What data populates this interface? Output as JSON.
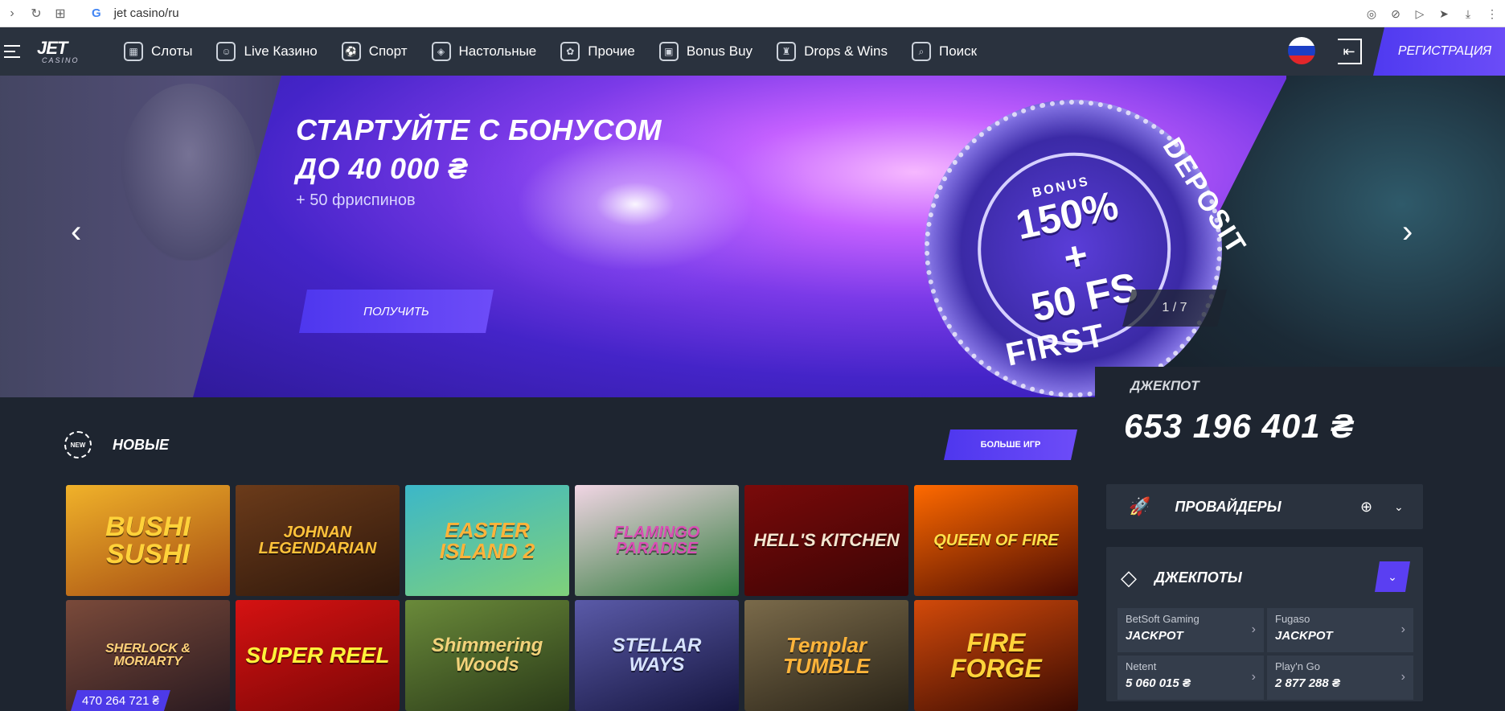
{
  "browser": {
    "url": "jet casino/ru",
    "google_letter": "G"
  },
  "header": {
    "logo_top": "JET",
    "logo_bottom": "CASINO",
    "nav": [
      {
        "label": "Слоты",
        "icon": "slots-icon"
      },
      {
        "label": "Live Казино",
        "icon": "live-dealer-icon"
      },
      {
        "label": "Спорт",
        "icon": "sport-icon"
      },
      {
        "label": "Настольные",
        "icon": "table-games-icon"
      },
      {
        "label": "Прочие",
        "icon": "other-games-icon"
      },
      {
        "label": "Bonus Buy",
        "icon": "gift-icon"
      },
      {
        "label": "Drops & Wins",
        "icon": "trophy-icon"
      },
      {
        "label": "Поиск",
        "icon": "search-icon"
      }
    ],
    "register_label": "РЕГИСТРАЦИЯ",
    "flag_colors": [
      "#ffffff",
      "#1c3fc6",
      "#e2262a"
    ]
  },
  "hero": {
    "title_line1": "СТАРТУЙТЕ С БОНУСОМ",
    "title_line2": "ДО 40 000 ₴",
    "subtitle": "+ 50 фриспинов",
    "button_label": "ПОЛУЧИТЬ",
    "badge_bonus": "BONUS",
    "badge_line1": "150%",
    "badge_plus": "+",
    "badge_line2": "50 FS",
    "badge_first": "FIRST",
    "badge_deposit": "DEPOSIT",
    "slide_counter": "1 / 7"
  },
  "new_games": {
    "icon_text": "NEW",
    "title": "НОВЫЕ",
    "more_label": "БОЛЬШЕ ИГР",
    "games": [
      {
        "name": "BUSHI SUSHI",
        "colors": [
          "#f0b22a",
          "#a44b12"
        ],
        "text_color": "#ffd23a",
        "size": 34
      },
      {
        "name": "JOHNAN LEGENDARIAN",
        "colors": [
          "#6b3b1a",
          "#2e170b"
        ],
        "text_color": "#ffc23a",
        "size": 20
      },
      {
        "name": "EASTER ISLAND 2",
        "colors": [
          "#3cb7c8",
          "#7fd17a"
        ],
        "text_color": "#ffb33a",
        "size": 26
      },
      {
        "name": "FLAMINGO PARADISE",
        "colors": [
          "#f1d5e4",
          "#2f7a3a"
        ],
        "text_color": "#d94fb5",
        "size": 20
      },
      {
        "name": "HELL'S KITCHEN",
        "colors": [
          "#7a0a0a",
          "#3a0404"
        ],
        "text_color": "#f4e6d0",
        "size": 22
      },
      {
        "name": "QUEEN OF FIRE",
        "colors": [
          "#ff6a00",
          "#4a0a02"
        ],
        "text_color": "#ffe14a",
        "size": 20
      },
      {
        "name": "SHERLOCK & MORIARTY",
        "colors": [
          "#7a4a3a",
          "#2a1a20"
        ],
        "text_color": "#ffd27a",
        "size": 16,
        "jackpot": "470 264 721 ₴"
      },
      {
        "name": "SUPER REEL",
        "colors": [
          "#d51212",
          "#7a0606"
        ],
        "text_color": "#fff23a",
        "size": 28
      },
      {
        "name": "Shimmering Woods",
        "colors": [
          "#6a8a3a",
          "#2a3a18"
        ],
        "text_color": "#f2d27a",
        "size": 24
      },
      {
        "name": "STELLAR WAYS",
        "colors": [
          "#5a5aa8",
          "#161640"
        ],
        "text_color": "#d7e3ff",
        "size": 24
      },
      {
        "name": "Templar TUMBLE",
        "colors": [
          "#7a6a4a",
          "#2a2418"
        ],
        "text_color": "#ffb43a",
        "size": 26
      },
      {
        "name": "FIRE FORGE",
        "colors": [
          "#d24a0a",
          "#3a0a02"
        ],
        "text_color": "#ffd43a",
        "size": 32
      }
    ]
  },
  "jackpot": {
    "label": "ДЖЕКПОТ",
    "value": "653 196 401 ₴"
  },
  "providers": {
    "title": "ПРОВАЙДЕРЫ"
  },
  "jackpots": {
    "title": "ДЖЕКПОТЫ",
    "cards": [
      {
        "provider": "BetSoft Gaming",
        "value": "JACKPOT"
      },
      {
        "provider": "Fugaso",
        "value": "JACKPOT"
      },
      {
        "provider": "Netent",
        "value": "5 060 015 ₴"
      },
      {
        "provider": "Play'n Go",
        "value": "2 877 288 ₴"
      }
    ]
  }
}
